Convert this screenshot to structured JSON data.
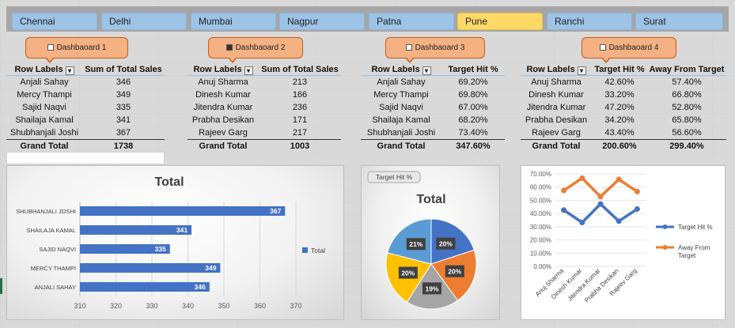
{
  "slicers": [
    {
      "label": "Chennai",
      "active": false
    },
    {
      "label": "Delhi",
      "active": false
    },
    {
      "label": "Mumbai",
      "active": false
    },
    {
      "label": "Nagpur",
      "active": false
    },
    {
      "label": "Patna",
      "active": false
    },
    {
      "label": "Pune",
      "active": true
    },
    {
      "label": "Ranchi",
      "active": false
    },
    {
      "label": "Surat",
      "active": false
    }
  ],
  "callouts": [
    "Dashbaoard 1",
    "Dashbaoard 2",
    "Dashbaoard 3",
    "Dashbaoard 4"
  ],
  "pivot1": {
    "headers": [
      "Row Labels",
      "Sum of Total Sales"
    ],
    "rows": [
      [
        "Anjali Sahay",
        "346"
      ],
      [
        "Mercy Thampi",
        "349"
      ],
      [
        "Sajid Naqvi",
        "335"
      ],
      [
        "Shailaja Kamal",
        "341"
      ],
      [
        "Shubhanjali Joshi",
        "367"
      ]
    ],
    "total": [
      "Grand Total",
      "1738"
    ]
  },
  "pivot2": {
    "headers": [
      "Row Labels",
      "Sum of Total Sales"
    ],
    "rows": [
      [
        "Anuj Sharma",
        "213"
      ],
      [
        "Dinesh Kumar",
        "166"
      ],
      [
        "Jitendra Kumar",
        "236"
      ],
      [
        "Prabha Desikan",
        "171"
      ],
      [
        "Rajeev Garg",
        "217"
      ]
    ],
    "total": [
      "Grand Total",
      "1003"
    ]
  },
  "pivot3": {
    "headers": [
      "Row Labels",
      "Target Hit %"
    ],
    "rows": [
      [
        "Anjali Sahay",
        "69.20%"
      ],
      [
        "Mercy Thampi",
        "69.80%"
      ],
      [
        "Sajid Naqvi",
        "67.00%"
      ],
      [
        "Shailaja Kamal",
        "68.20%"
      ],
      [
        "Shubhanjali Joshi",
        "73.40%"
      ]
    ],
    "total": [
      "Grand Total",
      "347.60%"
    ]
  },
  "pivot4": {
    "headers": [
      "Row Labels",
      "Target Hit %",
      "Away From Target"
    ],
    "rows": [
      [
        "Anuj Sharma",
        "42.60%",
        "57.40%"
      ],
      [
        "Dinesh Kumar",
        "33.20%",
        "66.80%"
      ],
      [
        "Jitendra Kumar",
        "47.20%",
        "52.80%"
      ],
      [
        "Prabha Desikan",
        "34.20%",
        "65.80%"
      ],
      [
        "Rajeev Garg",
        "43.40%",
        "56.60%"
      ]
    ],
    "total": [
      "Grand Total",
      "200.60%",
      "299.40%"
    ]
  },
  "colors": {
    "slicer": "#9dc3e6",
    "slicer_active": "#ffd966",
    "callout": "#f4b183",
    "bar": "#4472c4",
    "line_blue": "#4472c4",
    "line_orange": "#ed7d31"
  },
  "chart_data": [
    {
      "type": "bar",
      "orientation": "horizontal",
      "title": "Total",
      "categories": [
        "SHUBHANJALI JOSHI",
        "SHAILAJA KAMAL",
        "SAJID NAQVI",
        "MERCY THAMPI",
        "ANJALI SAHAY"
      ],
      "values": [
        367,
        341,
        335,
        349,
        346
      ],
      "series": [
        {
          "name": "Total",
          "values": [
            367,
            341,
            335,
            349,
            346
          ]
        }
      ],
      "xlim": [
        310,
        370
      ],
      "xticks": [
        310,
        320,
        330,
        340,
        350,
        360,
        370
      ],
      "data_labels": true,
      "legend": "right"
    },
    {
      "type": "pie",
      "title": "Total",
      "field_button": "Target Hit %",
      "slices": [
        {
          "value": 20,
          "label": "20%",
          "color": "#4472c4"
        },
        {
          "value": 20,
          "label": "20%",
          "color": "#ed7d31"
        },
        {
          "value": 19,
          "label": "19%",
          "color": "#a5a5a5"
        },
        {
          "value": 20,
          "label": "20%",
          "color": "#ffc000"
        },
        {
          "value": 21,
          "label": "21%",
          "color": "#5b9bd5"
        }
      ]
    },
    {
      "type": "line",
      "categories": [
        "Anuj Sharma",
        "Dinesh Kumar",
        "Jitendra Kumar",
        "Prabha Desikan",
        "Rajeev Garg"
      ],
      "series": [
        {
          "name": "Target Hit %",
          "values": [
            42.6,
            33.2,
            47.2,
            34.2,
            43.4
          ],
          "color": "#4472c4"
        },
        {
          "name": "Away From Target",
          "values": [
            57.4,
            66.8,
            52.8,
            65.8,
            56.6
          ],
          "color": "#ed7d31"
        }
      ],
      "ylim": [
        0,
        70
      ],
      "yticks": [
        "0.00%",
        "10.00%",
        "20.00%",
        "30.00%",
        "40.00%",
        "50.00%",
        "60.00%",
        "70.00%"
      ],
      "legend": "right"
    }
  ]
}
